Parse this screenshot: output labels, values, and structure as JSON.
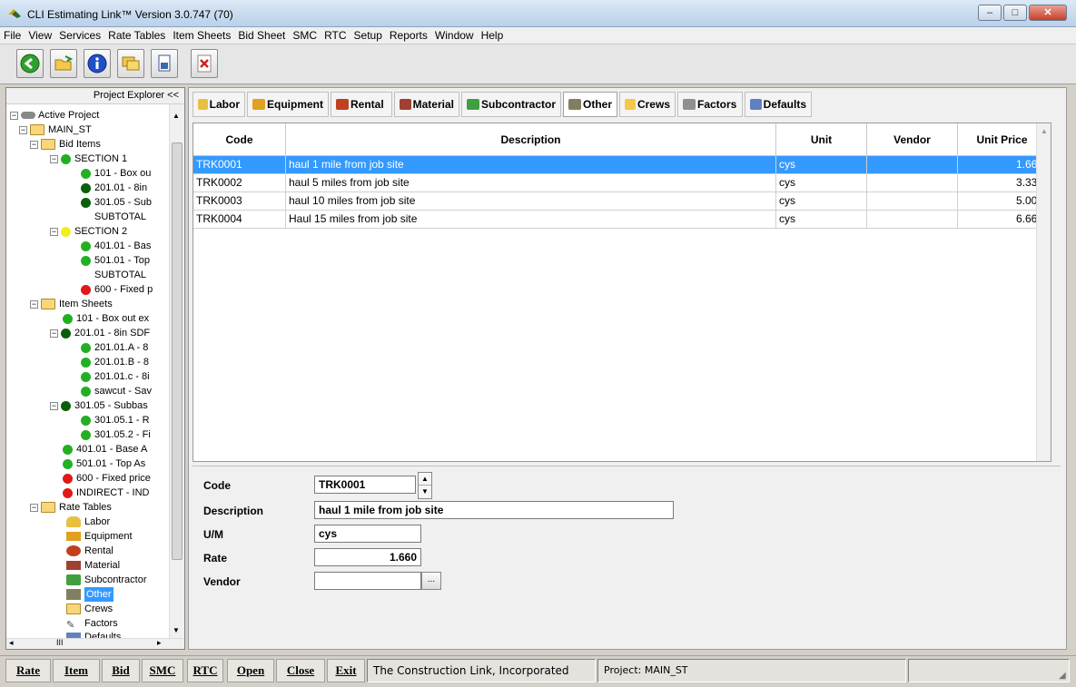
{
  "window": {
    "title": "CLI Estimating Link™ Version  3.0.747 (70)"
  },
  "menu": [
    "File",
    "View",
    "Services",
    "Rate Tables",
    "Item Sheets",
    "Bid Sheet",
    "SMC",
    "RTC",
    "Setup",
    "Reports",
    "Window",
    "Help"
  ],
  "toolbar": {
    "buttons": [
      "back-icon",
      "open-folder-icon",
      "info-icon",
      "folders-icon",
      "document-icon",
      "close-document-icon"
    ]
  },
  "explorer": {
    "header": "Project Explorer <<",
    "tree": [
      {
        "label": "Active Project"
      },
      {
        "label": "MAIN_ST"
      },
      {
        "label": "Bid Items"
      },
      {
        "label": "SECTION 1"
      },
      {
        "label": "101 - Box ou"
      },
      {
        "label": "201.01 - 8in"
      },
      {
        "label": "301.05 - Sub"
      },
      {
        "label": "SUBTOTAL"
      },
      {
        "label": "SECTION 2"
      },
      {
        "label": "401.01 - Bas"
      },
      {
        "label": "501.01 - Top"
      },
      {
        "label": "SUBTOTAL"
      },
      {
        "label": "600 - Fixed p"
      },
      {
        "label": "Item Sheets"
      },
      {
        "label": "101 - Box out ex"
      },
      {
        "label": "201.01 - 8in SDF"
      },
      {
        "label": "201.01.A - 8"
      },
      {
        "label": "201.01.B - 8"
      },
      {
        "label": "201.01.c - 8i"
      },
      {
        "label": "sawcut - Sav"
      },
      {
        "label": "301.05 - Subbas"
      },
      {
        "label": "301.05.1 - R"
      },
      {
        "label": "301.05.2 - Fi"
      },
      {
        "label": "401.01 - Base A"
      },
      {
        "label": "501.01 - Top As"
      },
      {
        "label": "600 - Fixed price"
      },
      {
        "label": "INDIRECT - IND"
      },
      {
        "label": "Rate Tables"
      },
      {
        "label": "Labor"
      },
      {
        "label": "Equipment"
      },
      {
        "label": "Rental"
      },
      {
        "label": "Material"
      },
      {
        "label": "Subcontractor"
      },
      {
        "label": "Other"
      },
      {
        "label": "Crews"
      },
      {
        "label": "Factors"
      },
      {
        "label": "Defaults"
      }
    ],
    "hscroll_label": "III"
  },
  "tabs": [
    "Labor",
    "Equipment",
    "Rental",
    "Material",
    "Subcontractor",
    "Other",
    "Crews",
    "Factors",
    "Defaults"
  ],
  "grid": {
    "headers": [
      "Code",
      "Description",
      "Unit",
      "Vendor",
      "Unit Price"
    ],
    "rows": [
      {
        "code": "TRK0001",
        "description": "haul 1 mile from job site",
        "unit": "cys",
        "vendor": "",
        "price": "1.660"
      },
      {
        "code": "TRK0002",
        "description": "haul 5 miles from job site",
        "unit": "cys",
        "vendor": "",
        "price": "3.330"
      },
      {
        "code": "TRK0003",
        "description": "haul 10 miles from job site",
        "unit": "cys",
        "vendor": "",
        "price": "5.000"
      },
      {
        "code": "TRK0004",
        "description": "Haul 15 miles from job site",
        "unit": "cys",
        "vendor": "",
        "price": "6.660"
      }
    ]
  },
  "detail": {
    "code_label": "Code",
    "code_value": "TRK0001",
    "description_label": "Description",
    "description_value": "haul 1 mile from job site",
    "um_label": "U/M",
    "um_value": "cys",
    "rate_label": "Rate",
    "rate_value": "1.660",
    "vendor_label": "Vendor",
    "vendor_value": "",
    "browse_label": "..."
  },
  "statusbar": {
    "buttons": [
      "Rate",
      "Item",
      "Bid",
      "SMC",
      "RTC",
      "Open",
      "Close",
      "Exit"
    ],
    "company": "The Construction Link, Incorporated",
    "project": "Project: MAIN_ST"
  }
}
